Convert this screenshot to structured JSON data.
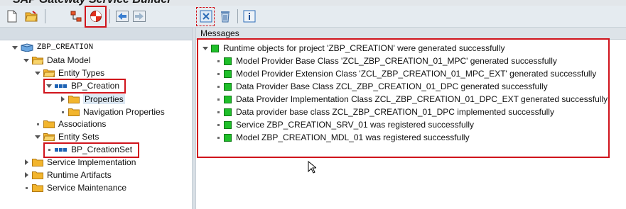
{
  "window": {
    "title": "SAP Gateway Service Builder"
  },
  "tree": {
    "root": "ZBP_CREATION",
    "data_model": "Data Model",
    "entity_types": "Entity Types",
    "bp_creation": "BP_Creation",
    "properties": "Properties",
    "navigation_properties": "Navigation Properties",
    "associations": "Associations",
    "entity_sets": "Entity Sets",
    "bp_creationset": "BP_CreationSet",
    "service_implementation": "Service Implementation",
    "runtime_artifacts": "Runtime Artifacts",
    "service_maintenance": "Service Maintenance"
  },
  "messages": {
    "header": "Messages",
    "root": "Runtime objects for project 'ZBP_CREATION' were generated successfully",
    "items": [
      "Model Provider Base Class 'ZCL_ZBP_CREATION_01_MPC' generated successfully",
      "Model Provider Extension Class 'ZCL_ZBP_CREATION_01_MPC_EXT' generated successfully",
      "Data Provider Base Class ZCL_ZBP_CREATION_01_DPC generated successfully",
      "Data Provider Implementation Class ZCL_ZBP_CREATION_01_DPC_EXT generated successfully",
      "Data provider base class ZCL_ZBP_CREATION_01_DPC implemented successfully",
      "Service ZBP_CREATION_SRV_01 was registered successfully",
      "Model ZBP_CREATION_MDL_01 was registered successfully"
    ]
  },
  "colors": {
    "highlight_box": "#d0141c",
    "success_square": "#1fbf2a",
    "folder": "#f2b52e",
    "entity_icon": "#1e63b5"
  },
  "icons": {
    "new": "new-document-icon",
    "open": "open-folder-icon",
    "hierarchy": "hierarchy-icon",
    "generate": "generate-runtime-icon",
    "back": "back-arrow-icon",
    "forward": "forward-arrow-icon",
    "close_messages": "close-messages-icon",
    "delete": "trash-icon",
    "info": "info-icon"
  }
}
